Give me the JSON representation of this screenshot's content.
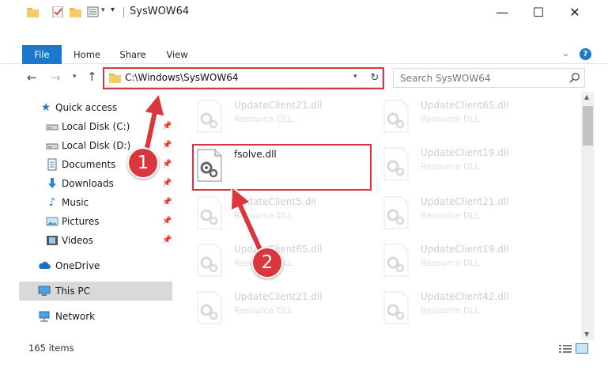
{
  "window": {
    "title": "SysWOW64",
    "icons": [
      "folder-icon",
      "check-properties-icon",
      "new-folder-icon",
      "properties-icon"
    ],
    "minimize": "—",
    "maximize": "☐",
    "close": "✕"
  },
  "ribbon": {
    "tabs": [
      {
        "label": "File"
      },
      {
        "label": "Home"
      },
      {
        "label": "Share"
      },
      {
        "label": "View"
      }
    ],
    "help": "?"
  },
  "address": {
    "path": "C:\\Windows\\SysWOW64",
    "search_placeholder": "Search SysWOW64"
  },
  "sidebar": {
    "items": [
      {
        "label": "Quick access",
        "icon": "star-icon"
      },
      {
        "label": "Local Disk (C:)",
        "icon": "drive-icon",
        "pinned": true
      },
      {
        "label": "Local Disk (D:)",
        "icon": "drive-icon",
        "pinned": true
      },
      {
        "label": "Documents",
        "icon": "documents-icon",
        "pinned": true
      },
      {
        "label": "Downloads",
        "icon": "download-icon",
        "pinned": true
      },
      {
        "label": "Music",
        "icon": "music-icon",
        "pinned": true
      },
      {
        "label": "Pictures",
        "icon": "pictures-icon",
        "pinned": true
      },
      {
        "label": "Videos",
        "icon": "videos-icon",
        "pinned": true
      },
      {
        "label": "OneDrive",
        "icon": "cloud-icon"
      },
      {
        "label": "This PC",
        "icon": "computer-icon",
        "selected": true
      },
      {
        "label": "Network",
        "icon": "network-icon"
      }
    ]
  },
  "files": {
    "left": [
      {
        "name": "UpdateClient21.dll",
        "type": "Resource DLL",
        "faded": true
      },
      {
        "name": "fsolve.dll",
        "type": "",
        "faded": false
      },
      {
        "name": "UpdateClient5.dll",
        "type": "Resource DLL",
        "faded": true
      },
      {
        "name": "UpdateClient65.dll",
        "type": "Resource DLL",
        "faded": true
      },
      {
        "name": "UpdateClient21.dll",
        "type": "Resource DLL",
        "faded": true
      }
    ],
    "right": [
      {
        "name": "UpdateClient65.dll",
        "type": "Resource DLL",
        "faded": true
      },
      {
        "name": "UpdateClient19.dll",
        "type": "Resource DLL",
        "faded": true
      },
      {
        "name": "UpdateClient21.dll",
        "type": "Resource DLL",
        "faded": true
      },
      {
        "name": "UpdateClient19.dll",
        "type": "Resource DLL",
        "faded": true
      },
      {
        "name": "UpdateClient42.dll",
        "type": "Resource DLL",
        "faded": true
      }
    ]
  },
  "status": {
    "count": "165 items"
  },
  "callouts": {
    "one": "1",
    "two": "2"
  },
  "colors": {
    "accent": "#1979ca",
    "highlight_red": "#d9363e",
    "selected_bg": "#d9d9d9"
  }
}
